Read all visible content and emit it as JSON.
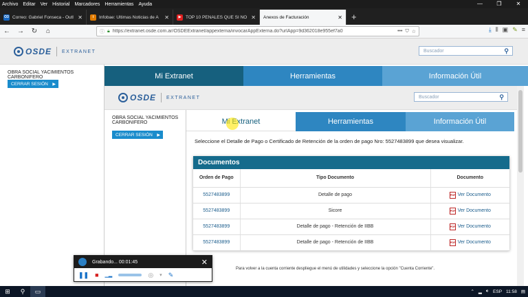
{
  "menu": [
    "Archivo",
    "Editar",
    "Ver",
    "Historial",
    "Marcadores",
    "Herramientas",
    "Ayuda"
  ],
  "window_controls": [
    "—",
    "❐",
    "✕"
  ],
  "tabs": [
    {
      "label": "Correo: Gabriel Fonseca - Outl",
      "favicon": "O3",
      "favcolor": "#1565c0"
    },
    {
      "label": "Infobae: Últimas Noticias de A",
      "favicon": "i",
      "favcolor": "#e07b00"
    },
    {
      "label": "TOP 10 PENALES QUE SI NO",
      "favicon": "▶",
      "favcolor": "#e02020"
    },
    {
      "label": "Anexos de Facturación",
      "favicon": "",
      "favcolor": "#f5f6f7"
    }
  ],
  "new_tab": "+",
  "url": "https://extranet.osde.com.ar/OSDEExtranet/appexterna/invocarAppExterna.do?urlApp=9d362018e955ef7a0",
  "brand": {
    "osde": "OSDE",
    "extranet": "EXTRANET"
  },
  "search_placeholder": "Buscador",
  "outer": {
    "org": "OBRA SOCIAL YACIMIENTOS CARBONIFERO",
    "logout": "CERRAR SESIÓN",
    "nav": [
      "Mi Extranet",
      "Herramientas",
      "Información Útil"
    ]
  },
  "inner": {
    "org": "OBRA SOCIAL YACIMIENTOS CARBONIFERO",
    "logout": "CERRAR SESIÓN",
    "nav": [
      "Mi Extranet",
      "Herramientas",
      "Información Útil"
    ],
    "prompt": "Seleccione el Detalle de Pago o Certificado de Retención de la orden de pago Nro: 5527483899 que desea visualizar.",
    "docs_title": "Documentos",
    "columns": [
      "Orden de Pago",
      "Tipo Documento",
      "Documento"
    ],
    "rows": [
      {
        "orden": "5527483899",
        "tipo": "Detalle de pago",
        "doc": "Ver Documento"
      },
      {
        "orden": "5527483899",
        "tipo": "Sicore",
        "doc": "Ver Documento"
      },
      {
        "orden": "5527483899",
        "tipo": "Detalle de pago - Retención de IIBB",
        "doc": "Ver Documento"
      },
      {
        "orden": "5527483899",
        "tipo": "Detalle de pago - Retención de IIBB",
        "doc": "Ver Documento"
      }
    ],
    "footnote": "Para volver a la cuenta corriente despliegue el menú de utilidades y seleccione la opción \"Cuenta Corriente\"."
  },
  "recorder": {
    "status": "Grabando... 00:01:45"
  },
  "tray": {
    "lang": "ESP",
    "time": "11:58"
  },
  "colors": {
    "nav_dark": "#16607e",
    "nav_mid": "#2e86c1",
    "nav_light": "#5aa3d4",
    "accent": "#1a8ccc"
  }
}
